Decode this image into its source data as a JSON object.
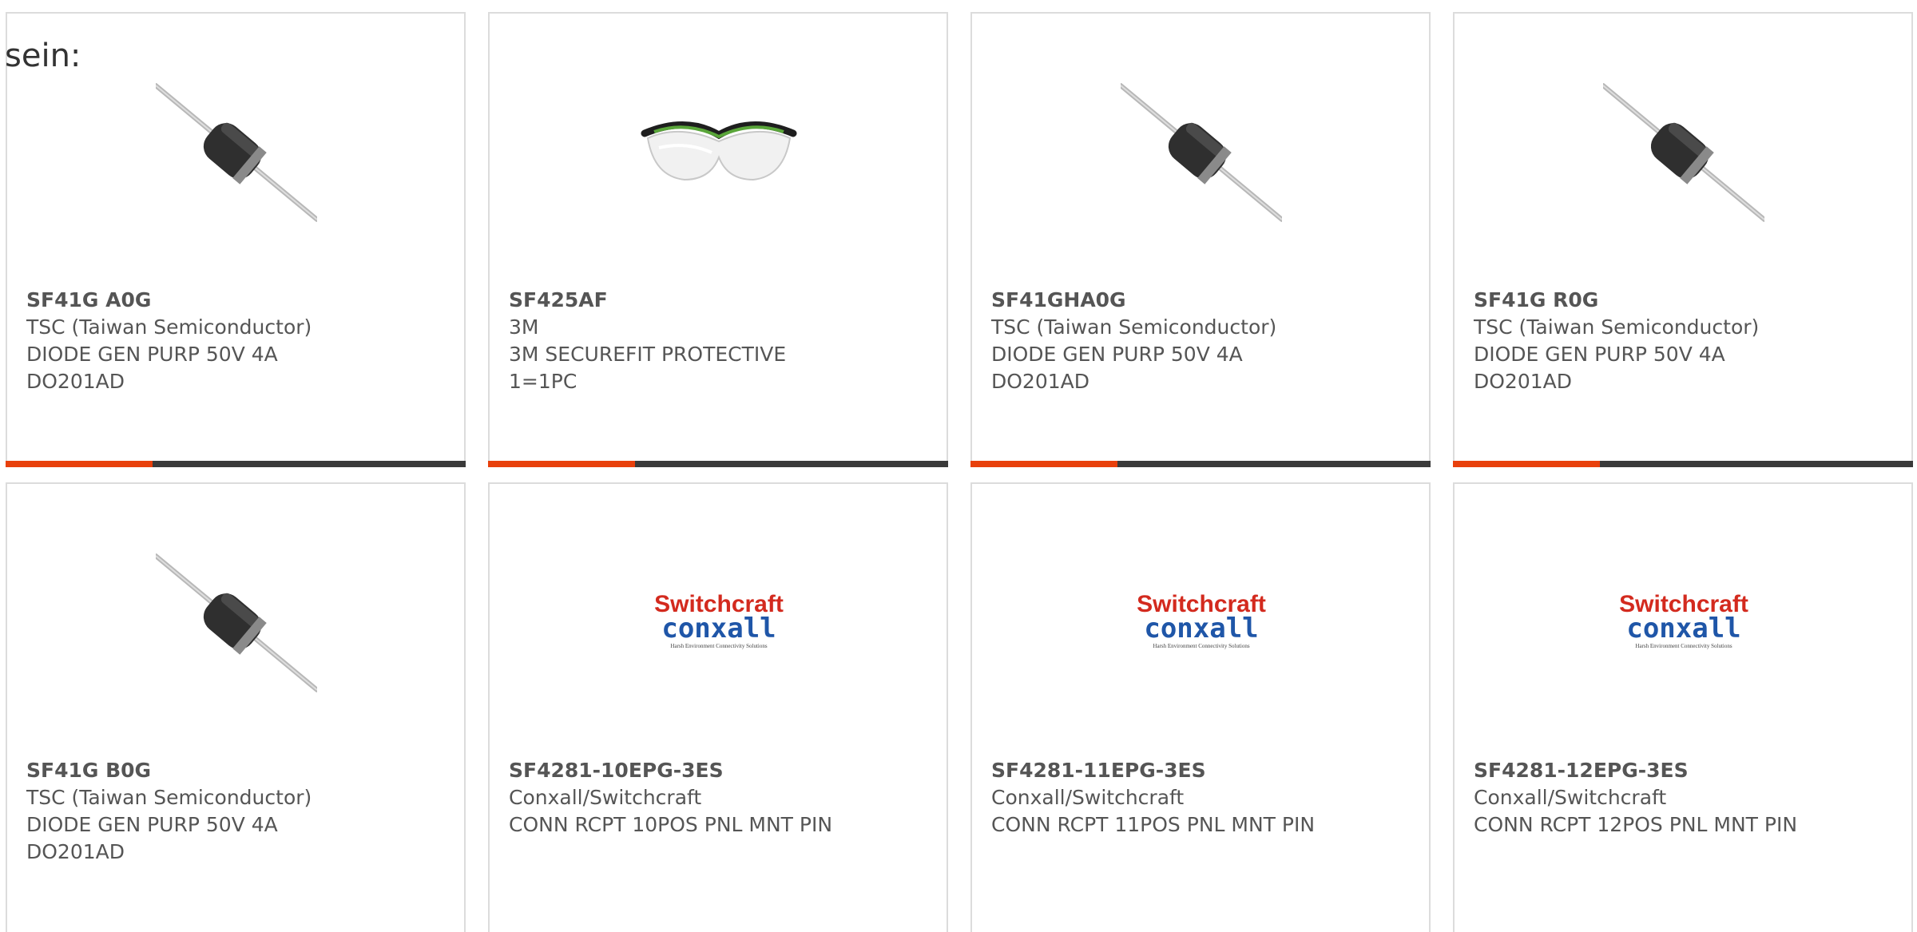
{
  "intro_text": "sein:",
  "colors": {
    "accent": "#e8400c",
    "bar_dark": "#3a3a3a",
    "text": "#555555",
    "border": "#dcdcdc"
  },
  "products": [
    {
      "part_number": "SF41G A0G",
      "manufacturer": "TSC (Taiwan Semiconductor)",
      "description_line1": "DIODE GEN PURP 50V 4A",
      "description_line2": "DO201AD",
      "image": "axial-diode-image"
    },
    {
      "part_number": "SF425AF",
      "manufacturer": "3M",
      "description_line1": "3M SECUREFIT PROTECTIVE",
      "description_line2": "1=1PC",
      "image": "safety-glasses-image"
    },
    {
      "part_number": "SF41GHA0G",
      "manufacturer": "TSC (Taiwan Semiconductor)",
      "description_line1": "DIODE GEN PURP 50V 4A",
      "description_line2": "DO201AD",
      "image": "axial-diode-image"
    },
    {
      "part_number": "SF41G R0G",
      "manufacturer": "TSC (Taiwan Semiconductor)",
      "description_line1": "DIODE GEN PURP 50V 4A",
      "description_line2": "DO201AD",
      "image": "axial-diode-image"
    },
    {
      "part_number": "SF41G B0G",
      "manufacturer": "TSC (Taiwan Semiconductor)",
      "description_line1": "DIODE GEN PURP 50V 4A",
      "description_line2": "DO201AD",
      "image": "axial-diode-image"
    },
    {
      "part_number": "SF4281-10EPG-3ES",
      "manufacturer": "Conxall/Switchcraft",
      "description_line1": "CONN RCPT 10POS PNL MNT PIN",
      "description_line2": "",
      "image": "switchcraft-conxall-logo"
    },
    {
      "part_number": "SF4281-11EPG-3ES",
      "manufacturer": "Conxall/Switchcraft",
      "description_line1": "CONN RCPT 11POS PNL MNT PIN",
      "description_line2": "",
      "image": "switchcraft-conxall-logo"
    },
    {
      "part_number": "SF4281-12EPG-3ES",
      "manufacturer": "Conxall/Switchcraft",
      "description_line1": "CONN RCPT 12POS PNL MNT PIN",
      "description_line2": "",
      "image": "switchcraft-conxall-logo"
    }
  ],
  "logo": {
    "line1": "Switchcraft",
    "line2": "conxall",
    "tagline": "Harsh Environment Connectivity Solutions"
  }
}
